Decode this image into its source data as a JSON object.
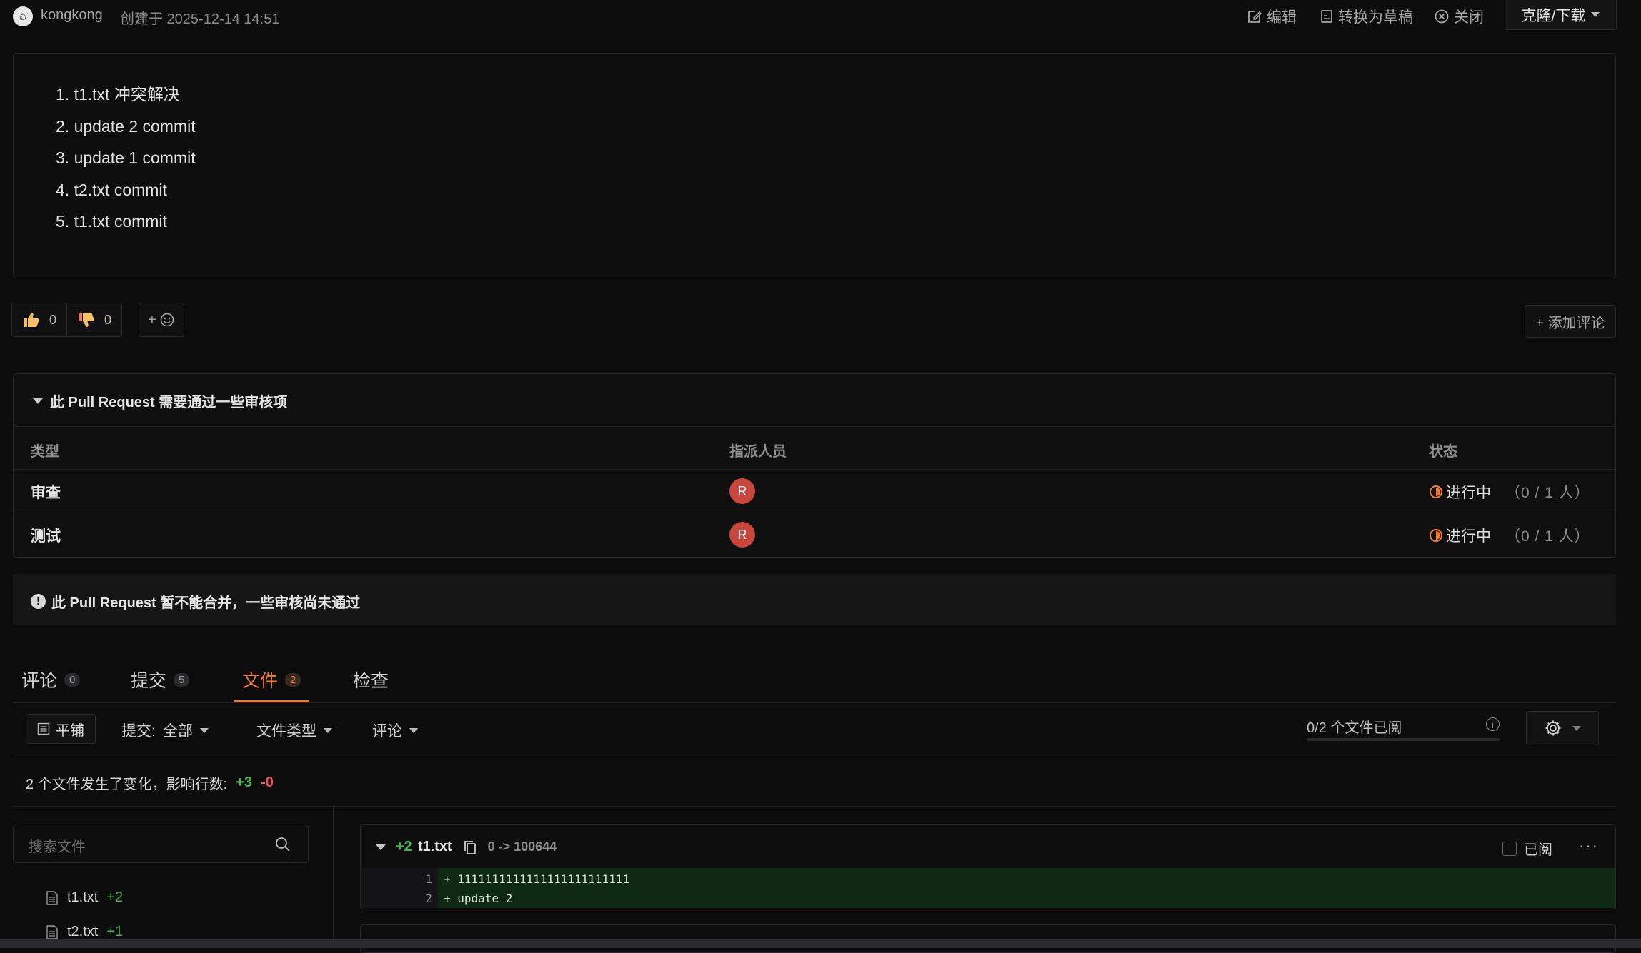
{
  "header": {
    "author": "kongkong",
    "created": "创建于 2025-12-14 14:51",
    "edit_label": "编辑",
    "draft_label": "转换为草稿",
    "close_label": "关闭",
    "clone_label": "克隆/下载"
  },
  "description": {
    "items": [
      "1. t1.txt 冲突解决",
      "2. update 2 commit",
      "3. update 1 commit",
      "4. t2.txt commit",
      "5. t1.txt commit"
    ]
  },
  "reactions": {
    "likes": "0",
    "dislikes": "0",
    "emoji_plus": "+",
    "add_comment": "+ 添加评论"
  },
  "review": {
    "title": "此 Pull Request 需要通过一些审核项",
    "col_type": "类型",
    "col_assignee": "指派人员",
    "col_status": "状态",
    "rows": [
      {
        "type": "审查",
        "assignee_initial": "R",
        "status": "进行中",
        "count": "（0 / 1 人）"
      },
      {
        "type": "测试",
        "assignee_initial": "R",
        "status": "进行中",
        "count": "（0 / 1 人）"
      }
    ]
  },
  "merge_warning": "此 Pull Request 暂不能合并，一些审核尚未通过",
  "tabs": [
    {
      "label": "评论",
      "count": "0"
    },
    {
      "label": "提交",
      "count": "5"
    },
    {
      "label": "文件",
      "count": "2"
    },
    {
      "label": "检查",
      "count": ""
    }
  ],
  "toolbar": {
    "tile_label": "平铺",
    "commit_filter_label": "提交:",
    "commit_filter_value": "全部",
    "filetype_label": "文件类型",
    "comment_label": "评论",
    "read_count": "0/2 个文件已阅",
    "read_progress": 0
  },
  "summary": {
    "text": "2 个文件发生了变化，影响行数:",
    "additions": "+3",
    "deletions": "-0"
  },
  "file_tree": {
    "search_placeholder": "搜索文件",
    "files": [
      {
        "name": "t1.txt",
        "changes": "+2"
      },
      {
        "name": "t2.txt",
        "changes": "+1"
      }
    ]
  },
  "diff": {
    "additions": "+2",
    "filename": "t1.txt",
    "mode": "0 -> 100644",
    "viewed_label": "已阅",
    "more": "···",
    "lines": [
      {
        "num": "1",
        "content": "+ 1111111111111111111111111"
      },
      {
        "num": "2",
        "content": "+ update 2"
      }
    ]
  },
  "colors": {
    "accent": "#f07b2e",
    "addition": "#3fb950",
    "deletion": "#f85149",
    "assignee_avatar": "#c9463d",
    "diff_add_bg": "#0f2a14"
  }
}
